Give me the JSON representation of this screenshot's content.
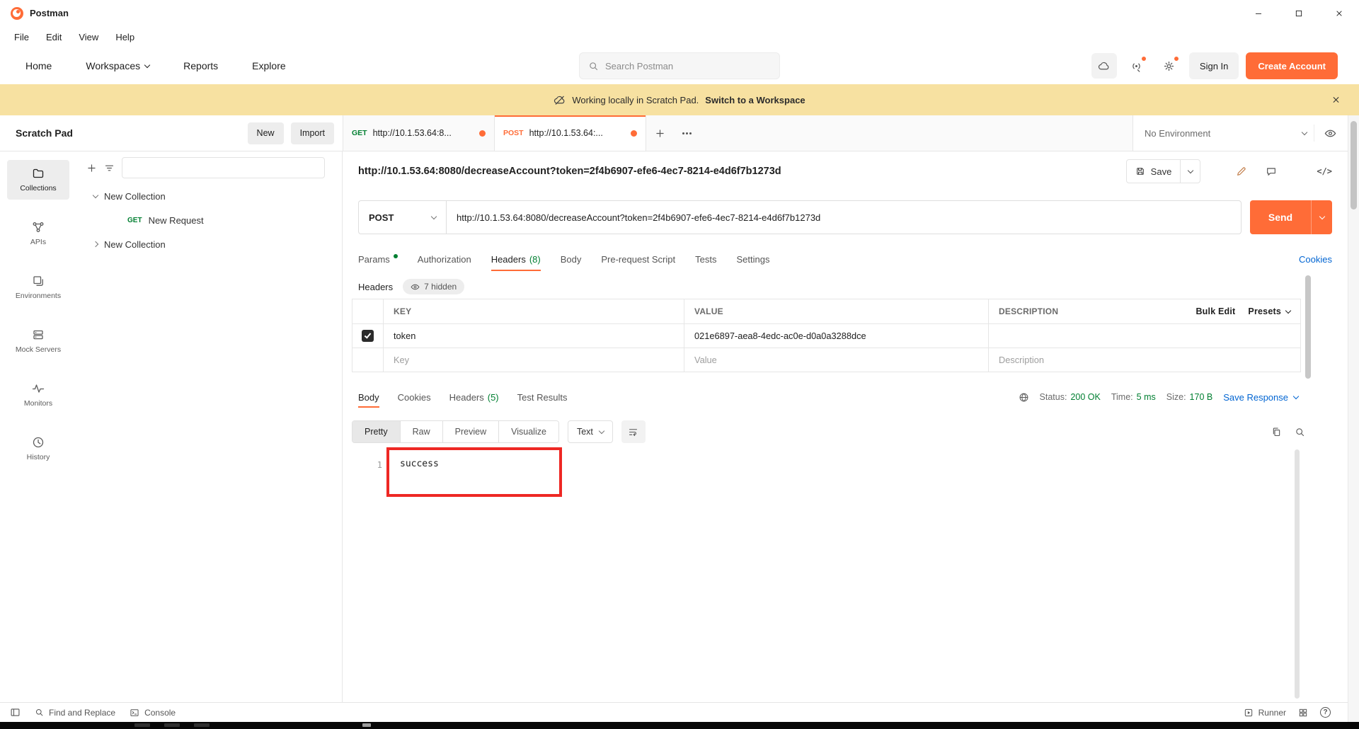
{
  "window": {
    "app_name": "Postman"
  },
  "menubar": {
    "items": [
      "File",
      "Edit",
      "View",
      "Help"
    ]
  },
  "nav": {
    "home": "Home",
    "workspaces": "Workspaces",
    "reports": "Reports",
    "explore": "Explore",
    "search_placeholder": "Search Postman",
    "sign_in": "Sign In",
    "create_account": "Create Account"
  },
  "banner": {
    "message": "Working locally in Scratch Pad.",
    "action": "Switch to a Workspace"
  },
  "scratchpad": {
    "title": "Scratch Pad",
    "new_button": "New",
    "import_button": "Import"
  },
  "tabbar": {
    "get_tab": {
      "method": "GET",
      "url": "http://10.1.53.64:8..."
    },
    "post_tab": {
      "method": "POST",
      "url": "http://10.1.53.64:..."
    },
    "environment": "No Environment"
  },
  "sidebar": {
    "items": [
      {
        "label": "Collections"
      },
      {
        "label": "APIs"
      },
      {
        "label": "Environments"
      },
      {
        "label": "Mock Servers"
      },
      {
        "label": "Monitors"
      },
      {
        "label": "History"
      }
    ],
    "tree": {
      "collection1": "New Collection",
      "request_method": "GET",
      "request_name": "New Request",
      "collection2": "New Collection"
    }
  },
  "request": {
    "title": "http://10.1.53.64:8080/decreaseAccount?token=2f4b6907-efe6-4ec7-8214-e4d6f7b1273d",
    "save_label": "Save",
    "method": "POST",
    "url": "http://10.1.53.64:8080/decreaseAccount?token=2f4b6907-efe6-4ec7-8214-e4d6f7b1273d",
    "send_label": "Send",
    "tabs": {
      "params": "Params",
      "authorization": "Authorization",
      "headers": "Headers",
      "headers_count": "(8)",
      "body": "Body",
      "prerequest": "Pre-request Script",
      "tests": "Tests",
      "settings": "Settings"
    },
    "cookies_link": "Cookies",
    "headers_section": {
      "label": "Headers",
      "hidden_badge": "7 hidden"
    },
    "table": {
      "columns": {
        "key": "KEY",
        "value": "VALUE",
        "description": "DESCRIPTION"
      },
      "bulk_edit": "Bulk Edit",
      "presets": "Presets",
      "row1": {
        "key": "token",
        "value": "021e6897-aea8-4edc-ac0e-d0a0a3288dce"
      },
      "placeholders": {
        "key": "Key",
        "value": "Value",
        "description": "Description"
      }
    }
  },
  "response": {
    "tabs": {
      "body": "Body",
      "cookies": "Cookies",
      "headers": "Headers",
      "headers_count": "(5)",
      "test_results": "Test Results"
    },
    "meta": {
      "status_label": "Status:",
      "status_value": "200 OK",
      "time_label": "Time:",
      "time_value": "5 ms",
      "size_label": "Size:",
      "size_value": "170 B",
      "save_response": "Save Response"
    },
    "views": [
      "Pretty",
      "Raw",
      "Preview",
      "Visualize"
    ],
    "format": "Text",
    "line_number": "1",
    "body_text": "success"
  },
  "statusbar": {
    "find_replace": "Find and Replace",
    "console": "Console",
    "runner": "Runner"
  },
  "icons": {
    "code_glyph": "</>",
    "help_glyph": "?"
  },
  "colors": {
    "accent_orange": "#ff6c37",
    "success_green": "#007f31",
    "link_blue": "#0265d2",
    "banner_yellow": "#f7e1a1",
    "annotation_red": "#ee2824"
  }
}
